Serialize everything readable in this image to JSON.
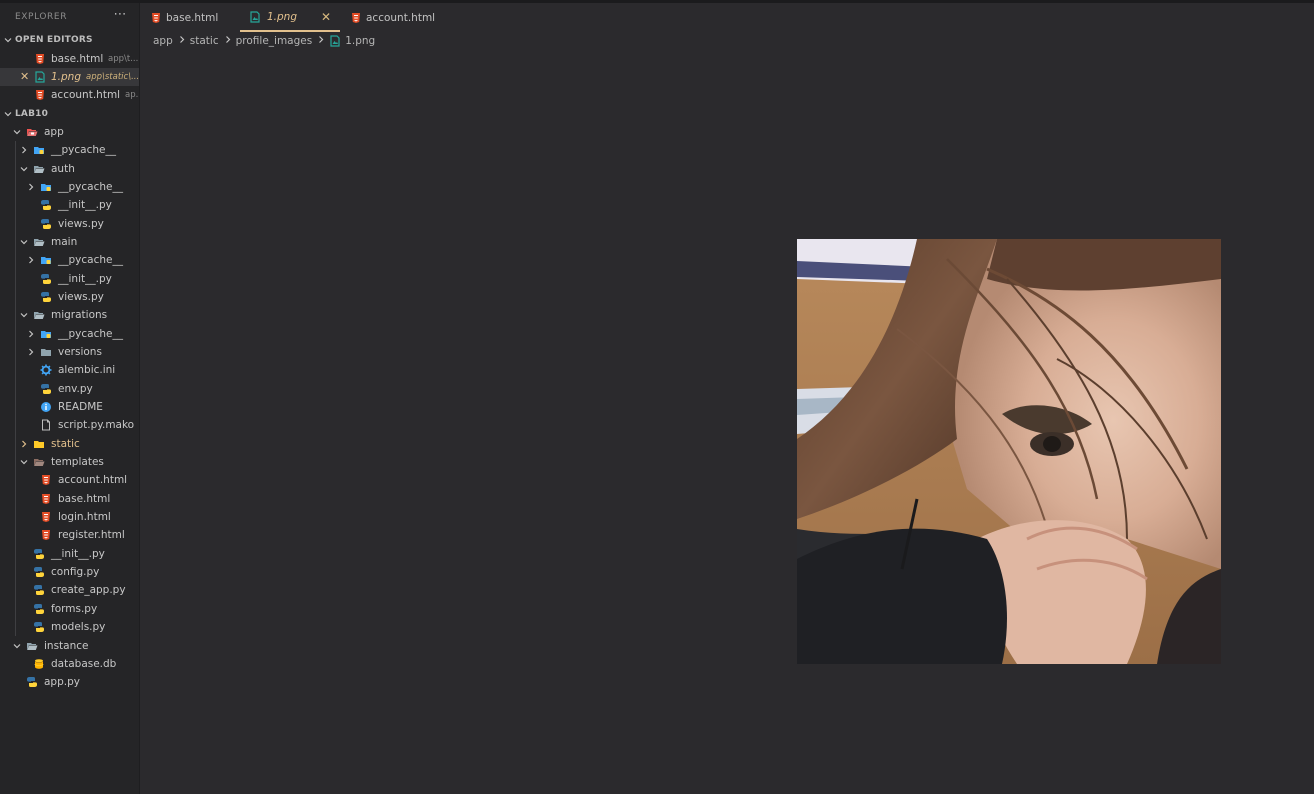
{
  "explorer": {
    "title": "EXPLORER",
    "more_icon": "ellipsis-icon",
    "open_editors": {
      "header": "OPEN EDITORS",
      "items": [
        {
          "name": "base.html",
          "path": "app\\t...",
          "icon": "html-file-icon",
          "active": false
        },
        {
          "name": "1.png",
          "path": "app\\static\\...",
          "icon": "image-file-icon",
          "active": true
        },
        {
          "name": "account.html",
          "path": "ap...",
          "icon": "html-file-icon",
          "active": false
        }
      ]
    },
    "workspace": {
      "header": "LAB10",
      "tree": [
        {
          "label": "app",
          "depth": 0,
          "type": "folder-open",
          "icon": "app-folder-icon"
        },
        {
          "label": "__pycache__",
          "depth": 1,
          "type": "folder-closed",
          "icon": "pycache-folder-icon"
        },
        {
          "label": "auth",
          "depth": 1,
          "type": "folder-open",
          "icon": "folder-open-icon"
        },
        {
          "label": "__pycache__",
          "depth": 2,
          "type": "folder-closed",
          "icon": "pycache-folder-icon"
        },
        {
          "label": "__init__.py",
          "depth": 2,
          "type": "file",
          "icon": "python-icon"
        },
        {
          "label": "views.py",
          "depth": 2,
          "type": "file",
          "icon": "python-icon"
        },
        {
          "label": "main",
          "depth": 1,
          "type": "folder-open",
          "icon": "folder-open-icon"
        },
        {
          "label": "__pycache__",
          "depth": 2,
          "type": "folder-closed",
          "icon": "pycache-folder-icon"
        },
        {
          "label": "__init__.py",
          "depth": 2,
          "type": "file",
          "icon": "python-icon"
        },
        {
          "label": "views.py",
          "depth": 2,
          "type": "file",
          "icon": "python-icon"
        },
        {
          "label": "migrations",
          "depth": 1,
          "type": "folder-open",
          "icon": "folder-open-icon"
        },
        {
          "label": "__pycache__",
          "depth": 2,
          "type": "folder-closed",
          "icon": "pycache-folder-icon"
        },
        {
          "label": "versions",
          "depth": 2,
          "type": "folder-closed",
          "icon": "folder-icon"
        },
        {
          "label": "alembic.ini",
          "depth": 2,
          "type": "file",
          "icon": "gear-icon"
        },
        {
          "label": "env.py",
          "depth": 2,
          "type": "file",
          "icon": "python-icon"
        },
        {
          "label": "README",
          "depth": 2,
          "type": "file",
          "icon": "info-icon"
        },
        {
          "label": "script.py.mako",
          "depth": 2,
          "type": "file",
          "icon": "file-icon"
        },
        {
          "label": "static",
          "depth": 1,
          "type": "folder-closed",
          "icon": "static-folder-icon",
          "highlight": true
        },
        {
          "label": "templates",
          "depth": 1,
          "type": "folder-open",
          "icon": "templates-folder-icon"
        },
        {
          "label": "account.html",
          "depth": 2,
          "type": "file",
          "icon": "html-file-icon"
        },
        {
          "label": "base.html",
          "depth": 2,
          "type": "file",
          "icon": "html-file-icon"
        },
        {
          "label": "login.html",
          "depth": 2,
          "type": "file",
          "icon": "html-file-icon"
        },
        {
          "label": "register.html",
          "depth": 2,
          "type": "file",
          "icon": "html-file-icon"
        },
        {
          "label": "__init__.py",
          "depth": 1,
          "type": "file",
          "icon": "python-icon"
        },
        {
          "label": "config.py",
          "depth": 1,
          "type": "file",
          "icon": "python-icon"
        },
        {
          "label": "create_app.py",
          "depth": 1,
          "type": "file",
          "icon": "python-icon"
        },
        {
          "label": "forms.py",
          "depth": 1,
          "type": "file",
          "icon": "python-icon"
        },
        {
          "label": "models.py",
          "depth": 1,
          "type": "file",
          "icon": "python-icon"
        },
        {
          "label": "instance",
          "depth": 0,
          "type": "folder-open",
          "icon": "folder-open-icon"
        },
        {
          "label": "database.db",
          "depth": 1,
          "type": "file",
          "icon": "database-icon"
        },
        {
          "label": "app.py",
          "depth": 0,
          "type": "file",
          "icon": "python-icon"
        }
      ]
    }
  },
  "tabs": [
    {
      "label": "base.html",
      "icon": "html-file-icon",
      "active": false
    },
    {
      "label": "1.png",
      "icon": "image-file-icon",
      "active": true
    },
    {
      "label": "account.html",
      "icon": "html-file-icon",
      "active": false
    }
  ],
  "breadcrumb": [
    {
      "label": "app",
      "icon": ""
    },
    {
      "label": "static",
      "icon": ""
    },
    {
      "label": "profile_images",
      "icon": ""
    },
    {
      "label": "1.png",
      "icon": "image-file-icon"
    }
  ],
  "preview": {
    "icon": "image-preview"
  },
  "colors": {
    "accent": "#e2c08d",
    "sidebar_bg": "#252527",
    "editor_bg": "#2b2a2d",
    "html_icon": "#e44d26",
    "image_icon": "#26a69a",
    "python_blue": "#3572a5",
    "python_yellow": "#ffd43b",
    "folder": "#90a4ae",
    "folder_blue": "#42a5f5",
    "folder_yellow": "#ffca28"
  }
}
